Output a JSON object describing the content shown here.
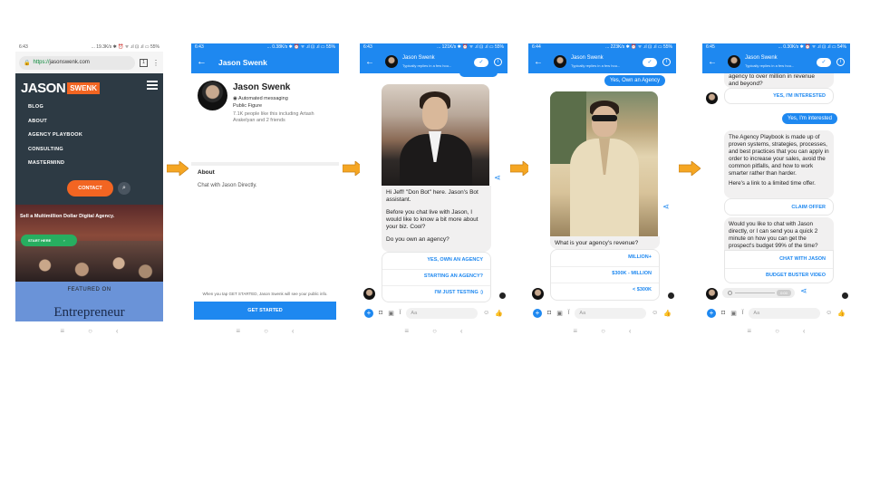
{
  "colors": {
    "messenger_blue": "#1e88f0",
    "site_dark": "#2d3a44",
    "brand_orange": "#f26522",
    "arrow_orange": "#f5a623"
  },
  "phone1": {
    "status_time": "6:43",
    "status_right": "... 19.3K/s ✱ ⏰ ᯤ .ıl ⊡ .ıl ▭ 55%",
    "url_scheme": "https://",
    "url_host": "jasonswenk.com",
    "tab_count": "1",
    "logo_jason": "JASON",
    "logo_swenk": "SWENK",
    "menu": [
      "BLOG",
      "ABOUT",
      "AGENCY PLAYBOOK",
      "CONSULTING",
      "MASTERMIND"
    ],
    "contact_label": "CONTACT",
    "hero_text": "Sell a Multimillion Dollar Digital Agency.",
    "start_label": "START HERE",
    "featured_label": "FEATURED ON",
    "featured_logo": "Entrepreneur"
  },
  "phone2": {
    "status_time": "6:43",
    "status_right": "... 0.38K/s ✱ ⏰ ᯤ .ıl ⊡ .ıl ▭ 55%",
    "title": "Jason Swenk",
    "name": "Jason Swenk",
    "automated": "Automated messaging",
    "category": "Public Figure",
    "likes": "7.1K people like this including Artash Arakelyan and 2 friends",
    "about_heading": "About",
    "about_text": "Chat with Jason Directly.",
    "notice": "When you tap GET STARTED, Jason Swenk will see your public info.",
    "cta": "GET STARTED"
  },
  "chat_header": {
    "name": "Jason Swenk",
    "subtitle": "Typically replies in a few hou..."
  },
  "phone3": {
    "status_time": "6:43",
    "status_right": "... 121K/s ✱ ⏰ ᯤ .ıl ⊡ .ıl ▭ 55%",
    "message": [
      "Hi Jeff!  \"Don Bot\" here. Jason's Bot assistant.",
      "Before you chat live with Jason, I would like to know a bit more about your biz. Cool?",
      "Do you own an agency?"
    ],
    "options": [
      "YES, OWN AN AGENCY",
      "STARTING AN AGENCY?",
      "I'M JUST TESTING :)"
    ]
  },
  "phone4": {
    "status_time": "6:44",
    "status_right": "... 223K/s ✱ ⏰ ᯤ .ıl ⊡ .ıl ▭ 55%",
    "user_reply": "Yes, Own an Agency",
    "question": "What is your agency's revenue?",
    "options": [
      "MILLION+",
      "$300K - MILLION",
      "< $300K"
    ]
  },
  "phone5": {
    "status_time": "6:45",
    "status_right": "... 0.30K/s ✱ ⏰ ᯤ .ıl ⊡ .ıl ▭ 54%",
    "top_text": [
      "agency to over million in revenue",
      "and beyond?"
    ],
    "option_interested": "YES, I'M INTERESTED",
    "user_reply": "Yes, I'm interested",
    "playbook_text": [
      "The Agency Playbook is made up of proven systems, strategies, processes, and best practices that you can apply in order to increase your sales, avoid the common pitfalls, and how to work smarter rather than harder.",
      "Here's a link to a limited time offer."
    ],
    "claim_label": "CLAIM OFFER",
    "call_text": "Would you like to chat with Jason directly, or I can send you a quick 2 minute on how you can get the prospect's budget 99% of the time?",
    "options": [
      "CHAT WITH JASON",
      "BUDGET BUSTER VIDEO"
    ],
    "audio_time": "0:00"
  },
  "composer": {
    "placeholder": "Aa"
  }
}
